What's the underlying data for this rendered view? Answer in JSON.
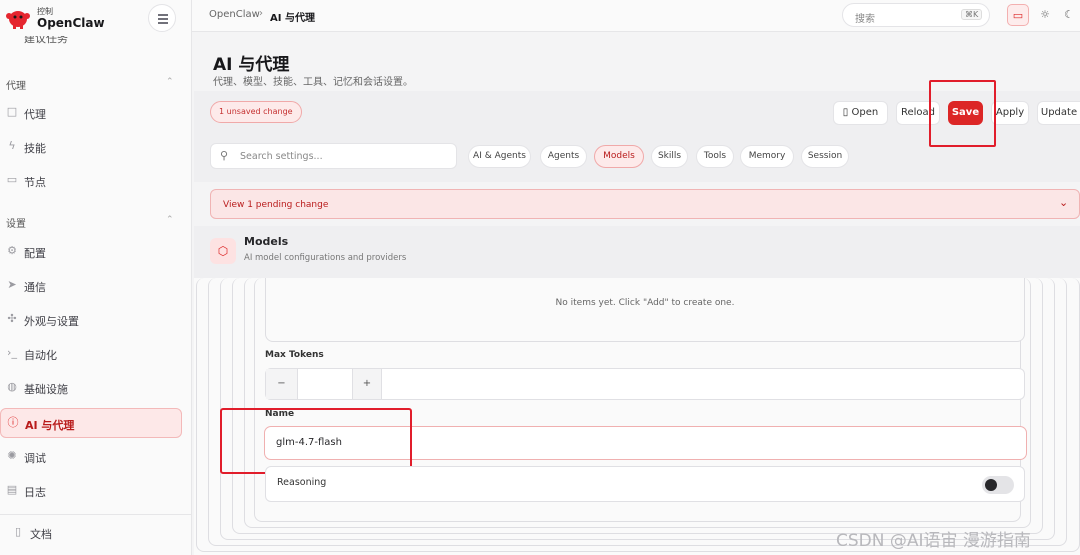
{
  "brand": {
    "sub": "控制",
    "name": "OpenClaw"
  },
  "sidebar": {
    "clipped_item": "建议任务",
    "section_agent": "代理",
    "agent_items": [
      {
        "label": "代理",
        "icon": "folder-icon"
      },
      {
        "label": "技能",
        "icon": "lightning-icon"
      },
      {
        "label": "节点",
        "icon": "monitor-icon"
      }
    ],
    "section_settings": "设置",
    "settings_items": [
      {
        "label": "配置",
        "icon": "gear-icon"
      },
      {
        "label": "通信",
        "icon": "send-icon"
      },
      {
        "label": "外观与设置",
        "icon": "puzzle-icon"
      },
      {
        "label": "自动化",
        "icon": "terminal-icon"
      },
      {
        "label": "基础设施",
        "icon": "globe-icon"
      },
      {
        "label": "AI 与代理",
        "icon": "ai-agent-icon",
        "active": true
      },
      {
        "label": "调试",
        "icon": "bug-icon"
      },
      {
        "label": "日志",
        "icon": "file-text-icon"
      }
    ],
    "docs": "文档"
  },
  "topbar": {
    "breadcrumb_root": "OpenClaw",
    "breadcrumb_sep": "›",
    "breadcrumb_current": "AI 与代理",
    "search_placeholder": "搜索",
    "search_shortcut": "⌘K"
  },
  "page": {
    "title": "AI 与代理",
    "subtitle": "代理、模型、技能、工具、记忆和会话设置。"
  },
  "toolbar": {
    "unsaved": "1 unsaved change",
    "open": "Open",
    "reload": "Reload",
    "save": "Save",
    "apply": "Apply",
    "update": "Update",
    "accent_color": "#dc2626"
  },
  "settings_search": {
    "placeholder": "Search settings..."
  },
  "tabs": [
    "AI & Agents",
    "Agents",
    "Models",
    "Skills",
    "Tools",
    "Memory",
    "Session"
  ],
  "active_tab": "Models",
  "pending": {
    "label": "View 1 pending change"
  },
  "models": {
    "title": "Models",
    "subtitle": "AI model configurations and providers",
    "empty_text": "No items yet. Click \"Add\" to create one.",
    "max_tokens_label": "Max Tokens",
    "max_tokens_value": "",
    "minus": "−",
    "plus": "+",
    "name_label": "Name",
    "name_value": "glm-4.7-flash",
    "reasoning_label": "Reasoning",
    "reasoning_enabled": false
  },
  "watermark": "CSDN @AI语宙 漫游指南"
}
